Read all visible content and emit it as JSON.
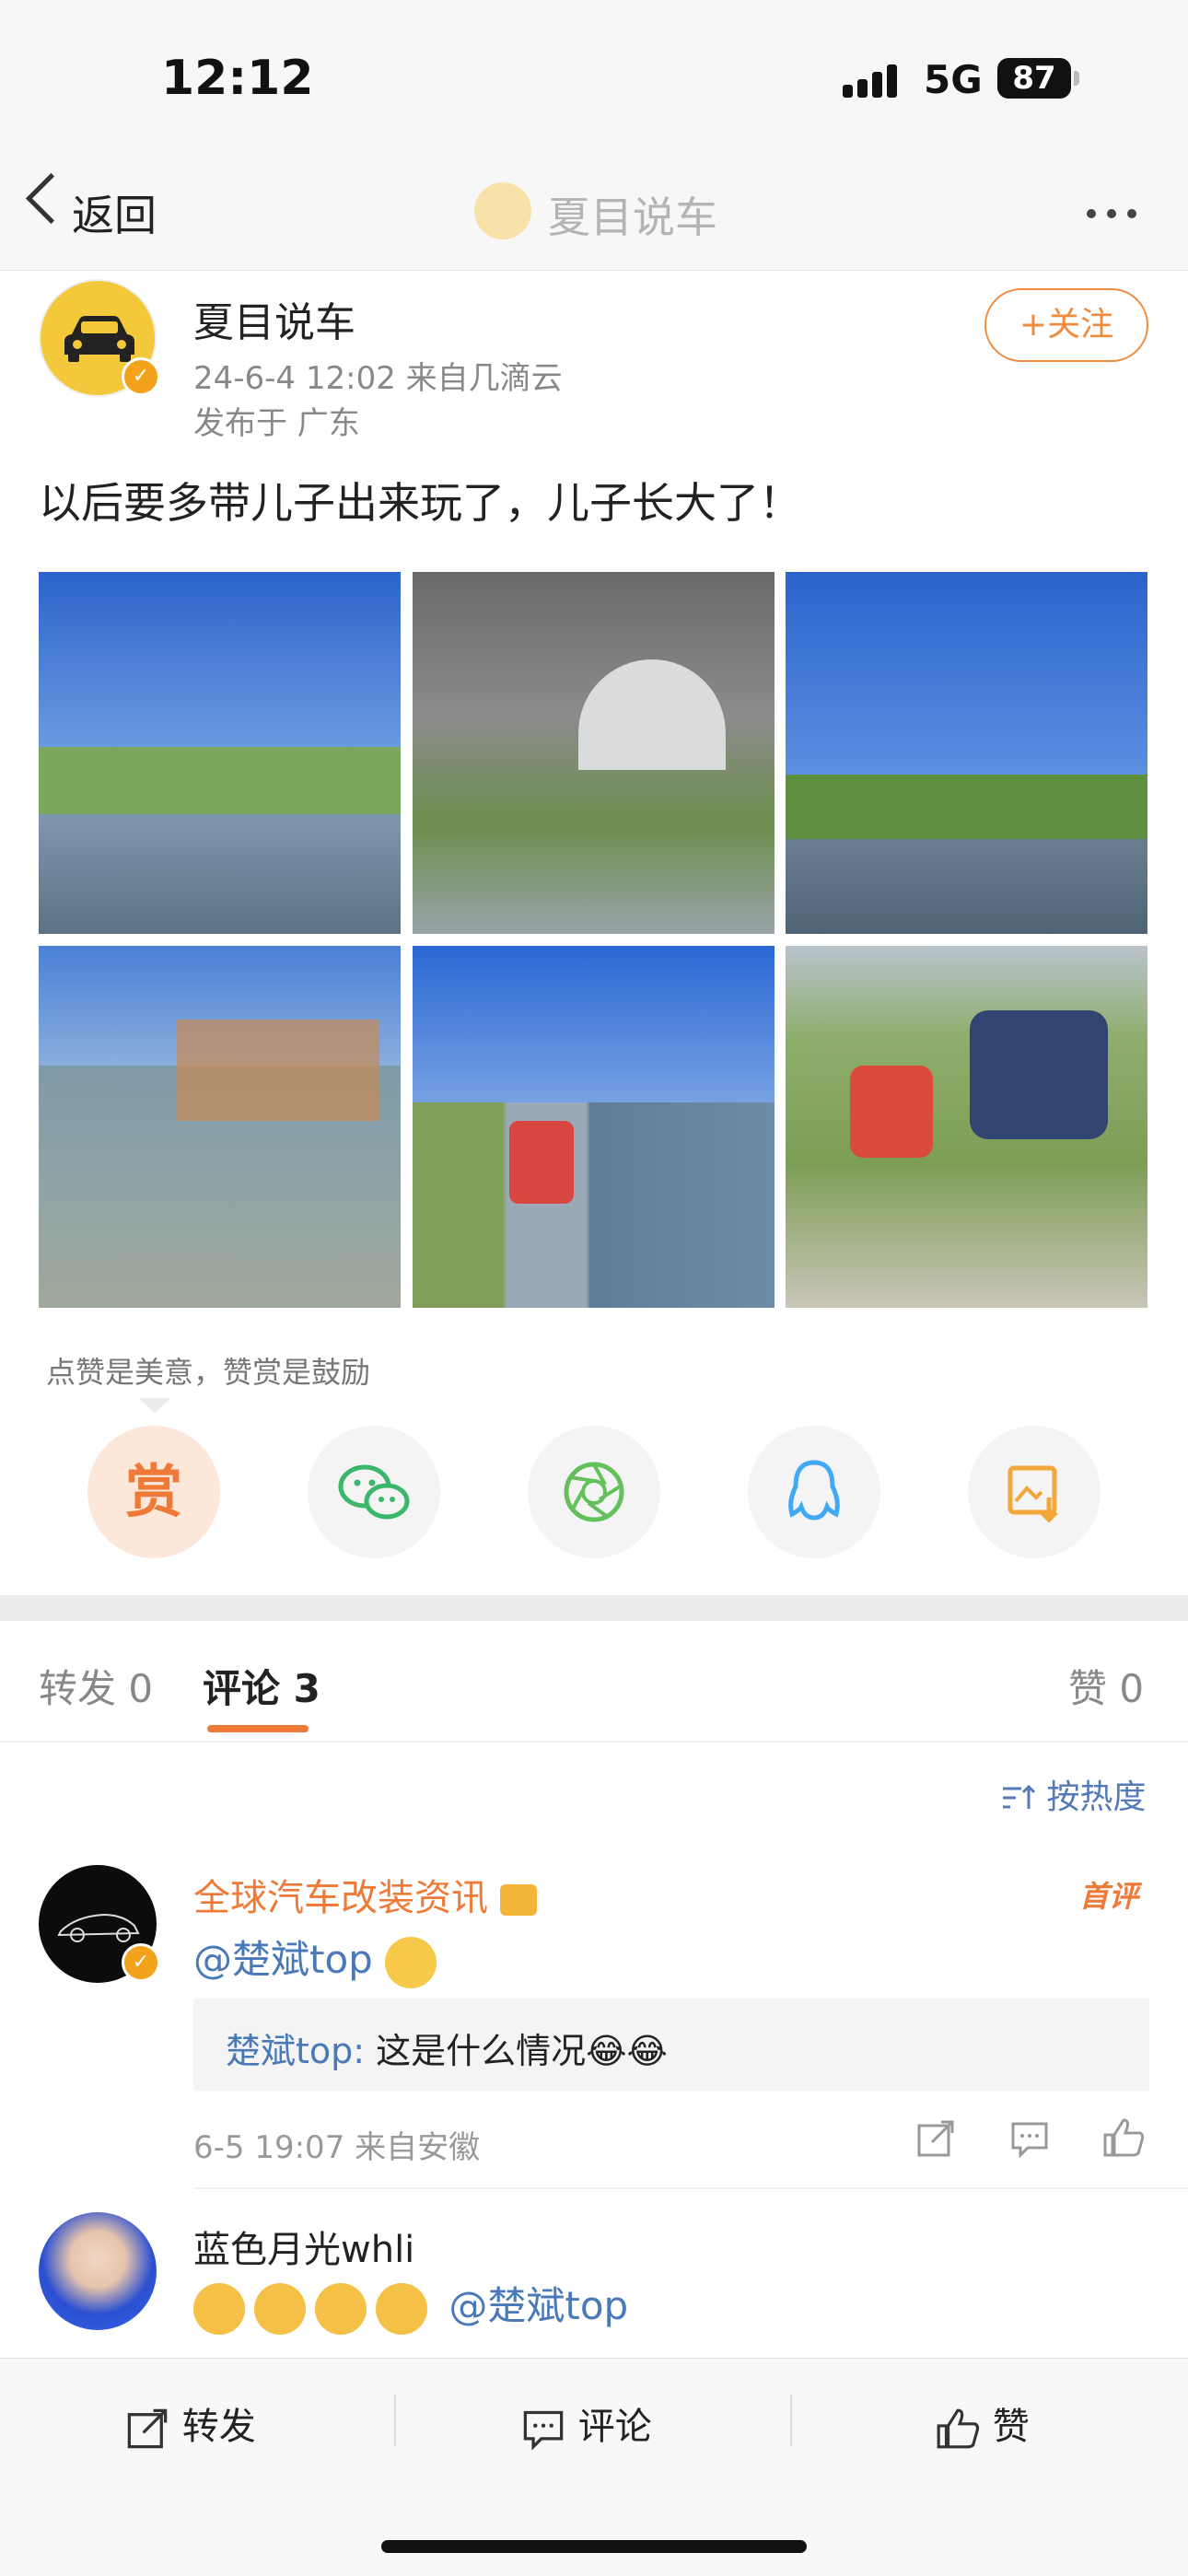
{
  "status_bar": {
    "time": "12:12",
    "network": "5G",
    "battery": "87"
  },
  "nav": {
    "back_label": "返回",
    "title": "夏目说车"
  },
  "post": {
    "author": "夏目说车",
    "meta_line1": "24-6-4 12:02  来自几滴云",
    "meta_line2": "发布于 广东",
    "follow_label": "+关注",
    "content": "以后要多带儿子出来玩了，儿子长大了！",
    "photo_count": 6
  },
  "reward": {
    "hint": "点赞是美意，赞赏是鼓励",
    "reward_label": "赏",
    "share_icons": [
      "wechat-icon",
      "moments-icon",
      "qq-icon",
      "save-image-icon"
    ]
  },
  "tabs": {
    "repost_label": "转发",
    "repost_count": "0",
    "comment_label": "评论",
    "comment_count": "3",
    "like_label": "赞",
    "like_count": "0"
  },
  "sort_label": "按热度",
  "comments": [
    {
      "name": "全球汽车改装资讯",
      "tag": "首评",
      "text_mention": "@楚斌top",
      "reply_author": "楚斌top:",
      "reply_text": " 这是什么情况😂😂",
      "meta": "6-5 19:07  来自安徽"
    },
    {
      "name": "蓝色月光whli",
      "text_mention": "@楚斌top"
    }
  ],
  "bottom_bar": {
    "repost": "转发",
    "comment": "评论",
    "like": "赞"
  },
  "colors": {
    "accent": "#ef7a38",
    "link": "#4a79b8",
    "follow": "#f08a3c"
  }
}
